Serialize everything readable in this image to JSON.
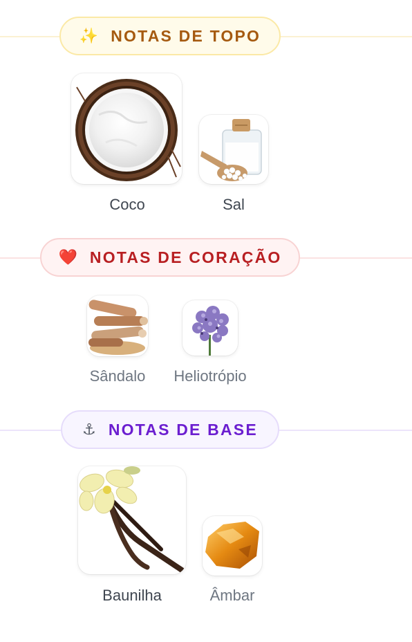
{
  "sections": [
    {
      "id": "top",
      "icon": "sparkles-icon",
      "icon_glyph": "✨",
      "title": "NOTAS DE TOPO",
      "color": "#a55a10",
      "notes": [
        {
          "name": "Coco",
          "image": "coconut-image"
        },
        {
          "name": "Sal",
          "image": "salt-jar-image"
        }
      ]
    },
    {
      "id": "heart",
      "icon": "heart-icon",
      "icon_glyph": "❤️",
      "title": "NOTAS DE CORAÇÃO",
      "color": "#b81f22",
      "notes": [
        {
          "name": "Sândalo",
          "image": "sandalwood-image"
        },
        {
          "name": "Heliotrópio",
          "image": "heliotrope-image"
        }
      ]
    },
    {
      "id": "base",
      "icon": "anchor-icon",
      "icon_glyph": "⚓",
      "title": "NOTAS DE BASE",
      "color": "#6b1ed0",
      "notes": [
        {
          "name": "Baunilha",
          "image": "vanilla-image"
        },
        {
          "name": "Âmbar",
          "image": "amber-image"
        }
      ]
    }
  ]
}
